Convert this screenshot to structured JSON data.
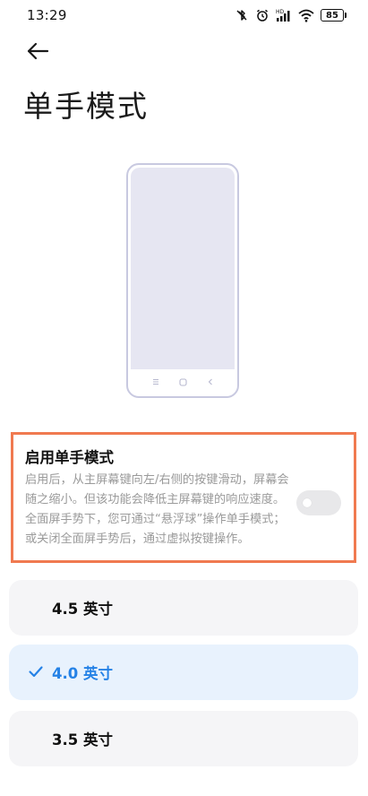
{
  "status_bar": {
    "time": "13:29",
    "battery_level": "85",
    "icons": [
      "bluetooth-off-icon",
      "alarm-icon",
      "signal-icon",
      "wifi-icon",
      "battery-icon"
    ]
  },
  "header": {
    "back_icon": "arrow-left-icon",
    "title": "单手模式"
  },
  "toggle": {
    "title": "启用单手模式",
    "description": "启用后，从主屏幕键向左/右侧的按键滑动，屏幕会随之缩小。但该功能会降低主屏幕键的响应速度。全面屏手势下，您可通过“悬浮球”操作单手模式；或关闭全面屏手势后，通过虚拟按键操作。",
    "enabled": false
  },
  "size_options": [
    {
      "label": "4.5 英寸",
      "selected": false
    },
    {
      "label": "4.0 英寸",
      "selected": true
    },
    {
      "label": "3.5 英寸",
      "selected": false
    }
  ],
  "colors": {
    "accent": "#2582e6",
    "selected_bg": "#e8f2fd",
    "option_bg": "#f5f5f7",
    "highlight_border": "#f07a50",
    "illustration": "#c8c9e0"
  }
}
